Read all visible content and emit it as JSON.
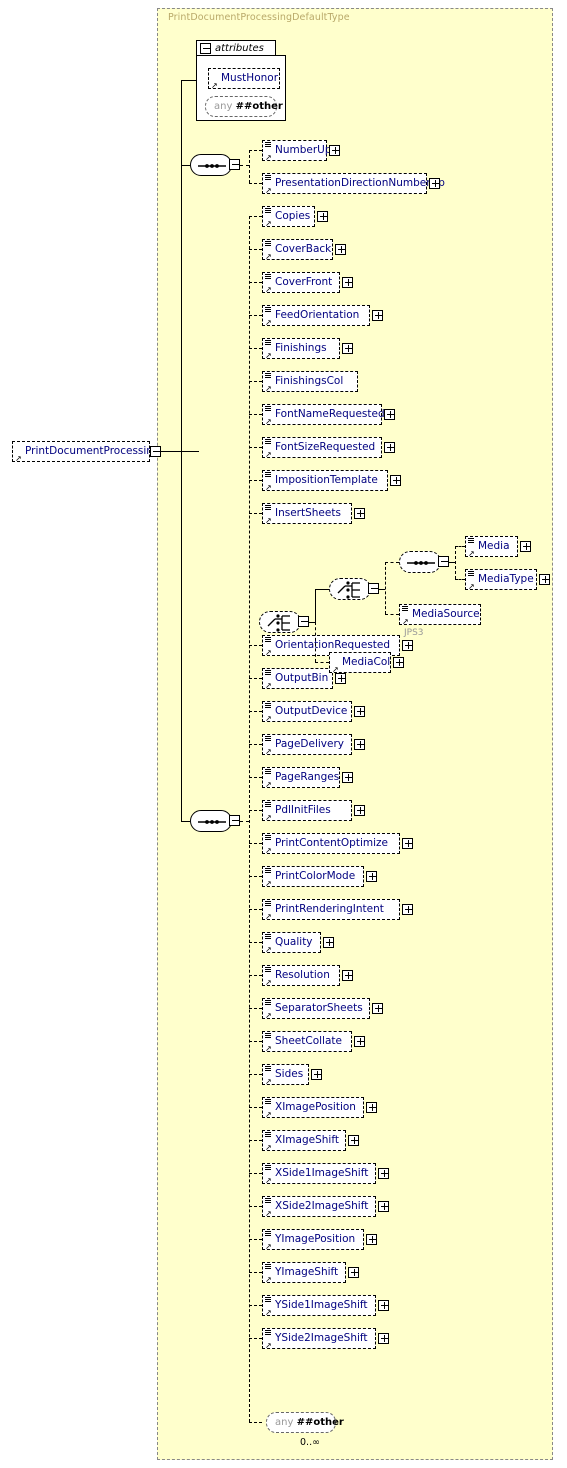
{
  "diagram": {
    "kind": "xml-schema-diagram",
    "root_element": {
      "name": "PrintDocumentProcessing",
      "control": "minus"
    },
    "type_box": {
      "title": "PrintDocumentProcessingDefaultType"
    },
    "attributes_group": {
      "label": "attributes",
      "control": "minus",
      "items": [
        {
          "name": "MustHonor",
          "kind": "attribute"
        },
        {
          "name_keyword": "any",
          "name_ns": "##other",
          "kind": "anyAttribute"
        }
      ]
    },
    "top_sequence": {
      "kind": "sequence",
      "control": "minus",
      "children": [
        {
          "name": "NumberUp",
          "control": "plus"
        },
        {
          "name": "PresentationDirectionNumberUp",
          "control": "plus"
        }
      ]
    },
    "main_sequence": {
      "kind": "sequence",
      "control": "minus",
      "children": [
        {
          "name": "Copies",
          "control": "plus"
        },
        {
          "name": "CoverBack",
          "control": "plus"
        },
        {
          "name": "CoverFront",
          "control": "plus"
        },
        {
          "name": "FeedOrientation",
          "control": "plus"
        },
        {
          "name": "Finishings",
          "control": "plus"
        },
        {
          "name": "FinishingsCol",
          "control": "none"
        },
        {
          "name": "FontNameRequested",
          "control": "plus"
        },
        {
          "name": "FontSizeRequested",
          "control": "plus"
        },
        {
          "name": "ImpositionTemplate",
          "control": "plus"
        },
        {
          "name": "InsertSheets",
          "control": "plus"
        },
        {
          "name": "OrientationRequested",
          "control": "plus"
        },
        {
          "name": "OutputBin",
          "control": "plus"
        },
        {
          "name": "OutputDevice",
          "control": "plus"
        },
        {
          "name": "PageDelivery",
          "control": "plus"
        },
        {
          "name": "PageRanges",
          "control": "plus"
        },
        {
          "name": "PdlInitFiles",
          "control": "plus"
        },
        {
          "name": "PrintContentOptimize",
          "control": "plus"
        },
        {
          "name": "PrintColorMode",
          "control": "plus"
        },
        {
          "name": "PrintRenderingIntent",
          "control": "plus"
        },
        {
          "name": "Quality",
          "control": "plus"
        },
        {
          "name": "Resolution",
          "control": "plus"
        },
        {
          "name": "SeparatorSheets",
          "control": "plus"
        },
        {
          "name": "SheetCollate",
          "control": "plus"
        },
        {
          "name": "Sides",
          "control": "plus"
        },
        {
          "name": "XImagePosition",
          "control": "plus"
        },
        {
          "name": "XImageShift",
          "control": "plus"
        },
        {
          "name": "XSide1ImageShift",
          "control": "plus"
        },
        {
          "name": "XSide2ImageShift",
          "control": "plus"
        },
        {
          "name": "YImagePosition",
          "control": "plus"
        },
        {
          "name": "YImageShift",
          "control": "plus"
        },
        {
          "name": "YSide1ImageShift",
          "control": "plus"
        },
        {
          "name": "YSide2ImageShift",
          "control": "plus"
        }
      ],
      "wildcard": {
        "name_keyword": "any",
        "name_ns": "##other",
        "occurrence": "0..∞"
      }
    },
    "media_branch": {
      "outer_choice": {
        "kind": "choice",
        "control": "minus"
      },
      "inner_choice": {
        "kind": "choice",
        "control": "minus"
      },
      "inner_sequence": {
        "kind": "sequence",
        "control": "minus"
      },
      "media": {
        "name": "Media",
        "control": "plus"
      },
      "media_type": {
        "name": "MediaType",
        "control": "plus"
      },
      "media_source": {
        "name": "MediaSource",
        "control": "none",
        "annotation": "JPS3"
      },
      "media_col": {
        "name": "MediaCol",
        "control": "plus"
      }
    },
    "colors": {
      "type_background": "#ffffcc",
      "type_border": "#888888",
      "node_text": "#00007f",
      "title_text": "#b9a96a",
      "annotation_text": "#999999",
      "shadow": "#bfbfbf"
    }
  }
}
